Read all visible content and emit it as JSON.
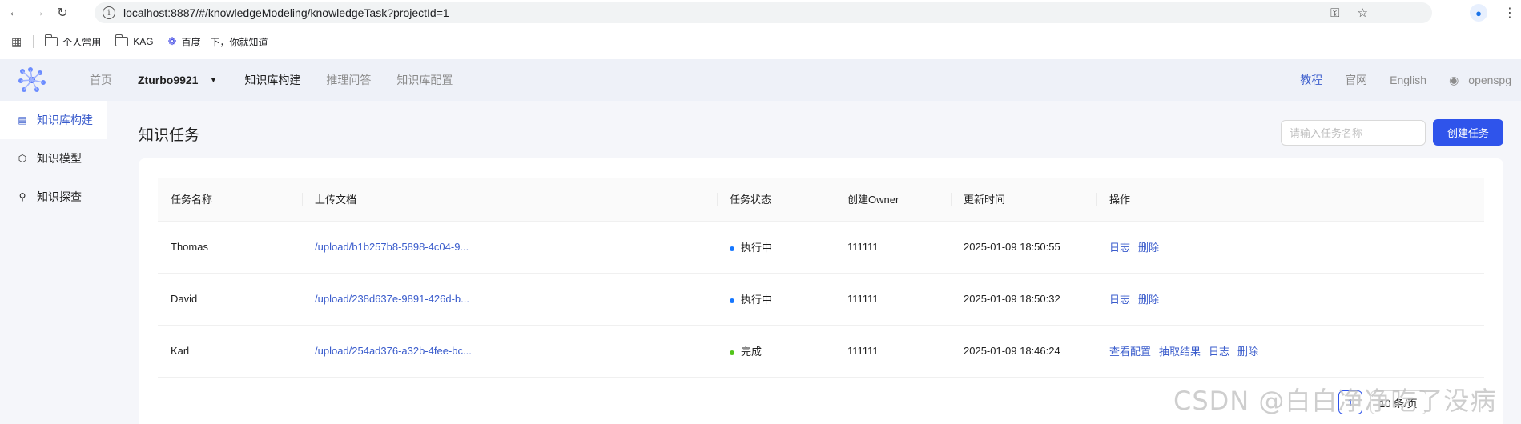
{
  "browser": {
    "url": "localhost:8887/#/knowledgeModeling/knowledgeTask?projectId=1",
    "bookmarks": [
      {
        "label": "个人常用",
        "icon": "folder-icon"
      },
      {
        "label": "KAG",
        "icon": "folder-icon"
      },
      {
        "label": "百度一下，你就知道",
        "icon": "baidu-paw-icon"
      }
    ]
  },
  "header": {
    "nav": [
      "首页",
      "Zturbo9921",
      "知识库构建",
      "推理问答",
      "知识库配置"
    ],
    "right_links": [
      "教程",
      "官网",
      "English",
      "openspg"
    ]
  },
  "sidebar": {
    "items": [
      {
        "label": "知识库构建",
        "icon": "document-icon"
      },
      {
        "label": "知识模型",
        "icon": "cube-icon"
      },
      {
        "label": "知识探查",
        "icon": "graph-icon"
      }
    ]
  },
  "main": {
    "title": "知识任务",
    "search_placeholder": "请输入任务名称",
    "create_label": "创建任务"
  },
  "table": {
    "columns": [
      "任务名称",
      "上传文档",
      "任务状态",
      "创建Owner",
      "更新时间",
      "操作"
    ],
    "rows": [
      {
        "name": "Thomas",
        "doc": "/upload/b1b257b8-5898-4c04-9...",
        "status": "执行中",
        "owner": "111111",
        "updated": "2025-01-09 18:50:55",
        "actions": [
          "日志",
          "删除"
        ]
      },
      {
        "name": "David",
        "doc": "/upload/238d637e-9891-426d-b...",
        "status": "执行中",
        "owner": "111111",
        "updated": "2025-01-09 18:50:32",
        "actions": [
          "日志",
          "删除"
        ]
      },
      {
        "name": "Karl",
        "doc": "/upload/254ad376-a32b-4fee-bc...",
        "status": "完成",
        "owner": "111111",
        "updated": "2025-01-09 18:46:24",
        "actions": [
          "查看配置",
          "抽取结果",
          "日志",
          "删除"
        ]
      }
    ]
  },
  "pagination": {
    "current": "1",
    "page_size": "10 条/页"
  },
  "watermark": "CSDN @白白净净吃了没病",
  "colors": {
    "accent": "#2f54eb",
    "link": "#3a5ccc",
    "status_running": "#1677ff",
    "status_done": "#52c41a"
  }
}
